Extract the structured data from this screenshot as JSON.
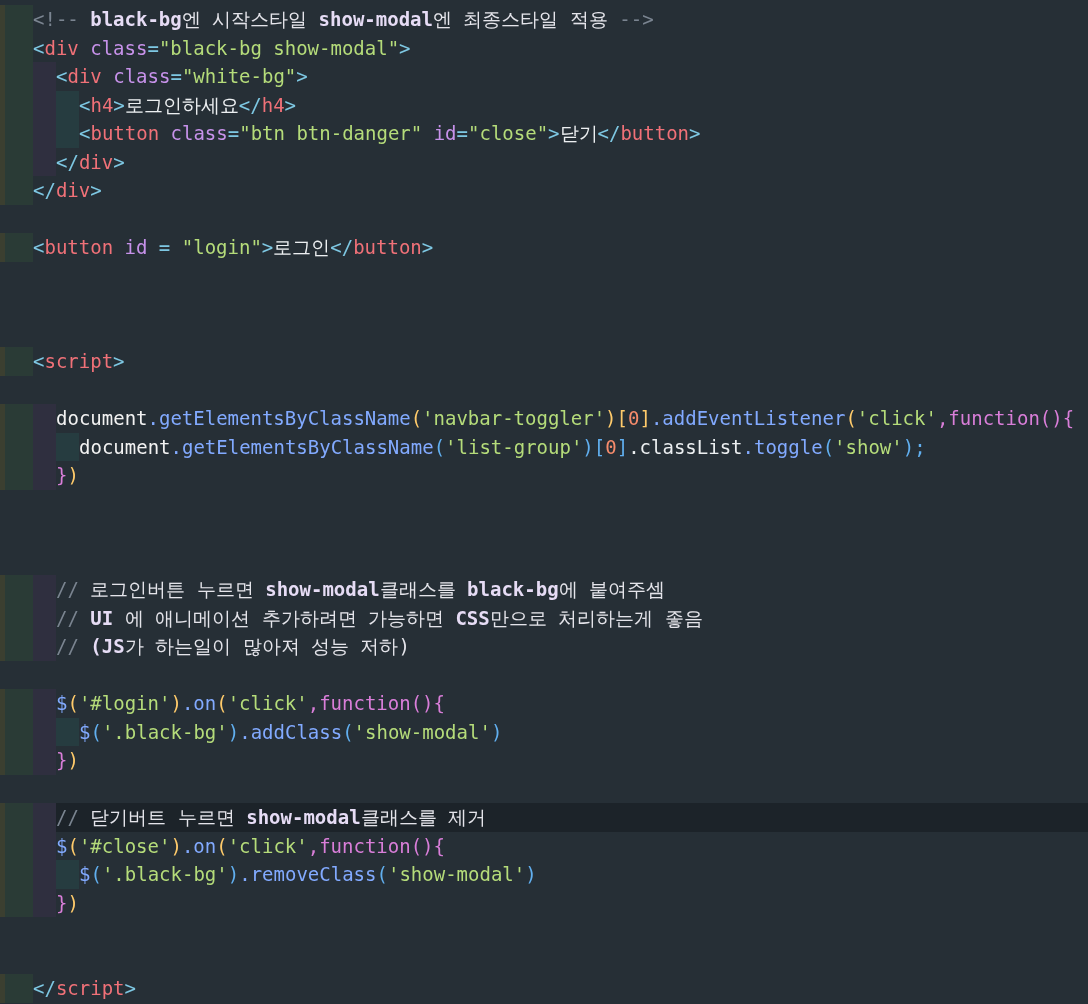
{
  "editor": {
    "lines": [
      {
        "highlighted": false,
        "tokens": [
          {
            "kind": "mark",
            "text": "<!-- "
          },
          {
            "kind": "ccode",
            "text": "black-bg"
          },
          {
            "kind": "ctext",
            "text": "엔 시작스타일 "
          },
          {
            "kind": "ccode",
            "text": "show-modal"
          },
          {
            "kind": "ctext",
            "text": "엔 최종스타일 적용 "
          },
          {
            "kind": "mark",
            "text": "-->"
          }
        ]
      },
      {
        "highlighted": false,
        "tokens": [
          {
            "kind": "punct",
            "text": "<"
          },
          {
            "kind": "tag",
            "text": "div"
          },
          {
            "kind": "attr",
            "text": " class"
          },
          {
            "kind": "punct",
            "text": "="
          },
          {
            "kind": "str",
            "text": "\"black-bg show-modal\""
          },
          {
            "kind": "punct",
            "text": ">"
          }
        ]
      },
      {
        "highlighted": false,
        "guides": [
          {
            "kind": "outer"
          }
        ],
        "tokens": [
          {
            "kind": "punct",
            "text": "<"
          },
          {
            "kind": "tag",
            "text": "div"
          },
          {
            "kind": "attr",
            "text": " class"
          },
          {
            "kind": "punct",
            "text": "="
          },
          {
            "kind": "str",
            "text": "\"white-bg\""
          },
          {
            "kind": "punct",
            "text": ">"
          }
        ]
      },
      {
        "highlighted": false,
        "guides": [
          {
            "kind": "outer"
          },
          {
            "kind": "inner"
          }
        ],
        "tokens": [
          {
            "kind": "punct",
            "text": "<"
          },
          {
            "kind": "tag",
            "text": "h4"
          },
          {
            "kind": "punct",
            "text": ">"
          },
          {
            "kind": "text",
            "text": "로그인하세요"
          },
          {
            "kind": "punct",
            "text": "</"
          },
          {
            "kind": "tag",
            "text": "h4"
          },
          {
            "kind": "punct",
            "text": ">"
          }
        ]
      },
      {
        "highlighted": false,
        "guides": [
          {
            "kind": "outer"
          },
          {
            "kind": "inner"
          }
        ],
        "tokens": [
          {
            "kind": "punct",
            "text": "<"
          },
          {
            "kind": "tag",
            "text": "button"
          },
          {
            "kind": "attr",
            "text": " class"
          },
          {
            "kind": "punct",
            "text": "="
          },
          {
            "kind": "str",
            "text": "\"btn btn-danger\""
          },
          {
            "kind": "attr",
            "text": " id"
          },
          {
            "kind": "punct",
            "text": "="
          },
          {
            "kind": "str",
            "text": "\"close\""
          },
          {
            "kind": "punct",
            "text": ">"
          },
          {
            "kind": "text",
            "text": "닫기"
          },
          {
            "kind": "punct",
            "text": "</"
          },
          {
            "kind": "tag",
            "text": "button"
          },
          {
            "kind": "punct",
            "text": ">"
          }
        ]
      },
      {
        "highlighted": false,
        "guides": [
          {
            "kind": "outer"
          }
        ],
        "tokens": [
          {
            "kind": "punct",
            "text": "</"
          },
          {
            "kind": "tag",
            "text": "div"
          },
          {
            "kind": "punct",
            "text": ">"
          }
        ]
      },
      {
        "highlighted": false,
        "tokens": [
          {
            "kind": "punct",
            "text": "</"
          },
          {
            "kind": "tag",
            "text": "div"
          },
          {
            "kind": "punct",
            "text": ">"
          }
        ]
      },
      {
        "highlighted": false
      },
      {
        "highlighted": false,
        "tokens": [
          {
            "kind": "punct",
            "text": "<"
          },
          {
            "kind": "tag",
            "text": "button"
          },
          {
            "kind": "attr",
            "text": " id"
          },
          {
            "kind": "punct",
            "text": " = "
          },
          {
            "kind": "str",
            "text": "\"login\""
          },
          {
            "kind": "punct",
            "text": ">"
          },
          {
            "kind": "text",
            "text": "로그인"
          },
          {
            "kind": "punct",
            "text": "</"
          },
          {
            "kind": "tag",
            "text": "button"
          },
          {
            "kind": "punct",
            "text": ">"
          }
        ]
      },
      {
        "highlighted": false
      },
      {
        "highlighted": false
      },
      {
        "highlighted": false
      },
      {
        "highlighted": false,
        "tokens": [
          {
            "kind": "punct",
            "text": "<"
          },
          {
            "kind": "tag",
            "text": "script"
          },
          {
            "kind": "punct",
            "text": ">"
          }
        ]
      },
      {
        "highlighted": false
      },
      {
        "highlighted": false,
        "guides": [
          {
            "kind": "outer"
          }
        ],
        "tokens": [
          {
            "kind": "ident",
            "text": "document"
          },
          {
            "kind": "method",
            "text": ".getElementsByClassName"
          },
          {
            "kind": "p1",
            "text": "("
          },
          {
            "kind": "str",
            "text": "'navbar-toggler'"
          },
          {
            "kind": "p1",
            "text": ")["
          },
          {
            "kind": "num",
            "text": "0"
          },
          {
            "kind": "p1",
            "text": "]"
          },
          {
            "kind": "method",
            "text": ".addEventListener"
          },
          {
            "kind": "p1",
            "text": "("
          },
          {
            "kind": "str",
            "text": "'click'"
          },
          {
            "kind": "kw",
            "text": ",function(){"
          }
        ]
      },
      {
        "highlighted": false,
        "guides": [
          {
            "kind": "outer"
          },
          {
            "kind": "inner"
          }
        ],
        "tokens": [
          {
            "kind": "ident",
            "text": "document"
          },
          {
            "kind": "method",
            "text": ".getElementsByClassName"
          },
          {
            "kind": "p2",
            "text": "("
          },
          {
            "kind": "str",
            "text": "'list-group'"
          },
          {
            "kind": "p2",
            "text": ")["
          },
          {
            "kind": "num",
            "text": "0"
          },
          {
            "kind": "p2",
            "text": "]"
          },
          {
            "kind": "text",
            "text": ".classList"
          },
          {
            "kind": "method",
            "text": ".toggle"
          },
          {
            "kind": "p2",
            "text": "("
          },
          {
            "kind": "str",
            "text": "'show'"
          },
          {
            "kind": "p2",
            "text": ");"
          }
        ]
      },
      {
        "highlighted": false,
        "guides": [
          {
            "kind": "outer"
          }
        ],
        "tokens": [
          {
            "kind": "kw",
            "text": "}"
          },
          {
            "kind": "p1",
            "text": ")"
          }
        ]
      },
      {
        "highlighted": false
      },
      {
        "highlighted": false
      },
      {
        "highlighted": false
      },
      {
        "highlighted": false,
        "guides": [
          {
            "kind": "outer"
          }
        ],
        "tokens": [
          {
            "kind": "mark",
            "text": "// "
          },
          {
            "kind": "ctext",
            "text": "로그인버튼 누르면 "
          },
          {
            "kind": "ccode",
            "text": "show-modal"
          },
          {
            "kind": "ctext",
            "text": "클래스를 "
          },
          {
            "kind": "ccode",
            "text": "black-bg"
          },
          {
            "kind": "ctext",
            "text": "에 붙여주셈"
          }
        ]
      },
      {
        "highlighted": false,
        "guides": [
          {
            "kind": "outer"
          }
        ],
        "tokens": [
          {
            "kind": "mark",
            "text": "// "
          },
          {
            "kind": "ccode",
            "text": "UI"
          },
          {
            "kind": "ctext",
            "text": " 에 애니메이션 추가하려면 가능하면 "
          },
          {
            "kind": "ccode",
            "text": "CSS"
          },
          {
            "kind": "ctext",
            "text": "만으로 처리하는게 좋음"
          }
        ]
      },
      {
        "highlighted": false,
        "guides": [
          {
            "kind": "outer"
          }
        ],
        "tokens": [
          {
            "kind": "mark",
            "text": "// "
          },
          {
            "kind": "ccode",
            "text": "(JS"
          },
          {
            "kind": "ctext",
            "text": "가 하는일이 많아져 성능 저하)"
          }
        ]
      },
      {
        "highlighted": false
      },
      {
        "highlighted": false,
        "guides": [
          {
            "kind": "outer"
          }
        ],
        "tokens": [
          {
            "kind": "method",
            "text": "$"
          },
          {
            "kind": "p1",
            "text": "("
          },
          {
            "kind": "str",
            "text": "'#login'"
          },
          {
            "kind": "p1",
            "text": ")"
          },
          {
            "kind": "method",
            "text": ".on"
          },
          {
            "kind": "p1",
            "text": "("
          },
          {
            "kind": "str",
            "text": "'click'"
          },
          {
            "kind": "kw",
            "text": ",function(){"
          }
        ]
      },
      {
        "highlighted": false,
        "guides": [
          {
            "kind": "outer"
          },
          {
            "kind": "inner"
          }
        ],
        "tokens": [
          {
            "kind": "method",
            "text": "$"
          },
          {
            "kind": "p2",
            "text": "("
          },
          {
            "kind": "str",
            "text": "'.black-bg'"
          },
          {
            "kind": "p2",
            "text": ")"
          },
          {
            "kind": "method",
            "text": ".addClass"
          },
          {
            "kind": "p2",
            "text": "("
          },
          {
            "kind": "str",
            "text": "'show-modal'"
          },
          {
            "kind": "p2",
            "text": ")"
          }
        ]
      },
      {
        "highlighted": false,
        "guides": [
          {
            "kind": "outer"
          }
        ],
        "tokens": [
          {
            "kind": "kw",
            "text": "}"
          },
          {
            "kind": "p1",
            "text": ")"
          }
        ]
      },
      {
        "highlighted": false
      },
      {
        "highlighted": true,
        "guides": [
          {
            "kind": "outer"
          }
        ],
        "tokens": [
          {
            "kind": "mark",
            "text": "// "
          },
          {
            "kind": "ctext",
            "text": "닫기버트 누르면 "
          },
          {
            "kind": "ccode",
            "text": "show-modal"
          },
          {
            "kind": "ctext",
            "text": "클래스를 제거"
          }
        ]
      },
      {
        "highlighted": false,
        "guides": [
          {
            "kind": "outer"
          }
        ],
        "tokens": [
          {
            "kind": "method",
            "text": "$"
          },
          {
            "kind": "p1",
            "text": "("
          },
          {
            "kind": "str",
            "text": "'#close'"
          },
          {
            "kind": "p1",
            "text": ")"
          },
          {
            "kind": "method",
            "text": ".on"
          },
          {
            "kind": "p1",
            "text": "("
          },
          {
            "kind": "str",
            "text": "'click'"
          },
          {
            "kind": "kw",
            "text": ",function(){"
          }
        ]
      },
      {
        "highlighted": false,
        "guides": [
          {
            "kind": "outer"
          },
          {
            "kind": "inner"
          }
        ],
        "tokens": [
          {
            "kind": "method",
            "text": "$"
          },
          {
            "kind": "p2",
            "text": "("
          },
          {
            "kind": "str",
            "text": "'.black-bg'"
          },
          {
            "kind": "p2",
            "text": ")"
          },
          {
            "kind": "method",
            "text": ".removeClass"
          },
          {
            "kind": "p2",
            "text": "("
          },
          {
            "kind": "str",
            "text": "'show-modal'"
          },
          {
            "kind": "p2",
            "text": ")"
          }
        ]
      },
      {
        "highlighted": false,
        "guides": [
          {
            "kind": "outer"
          }
        ],
        "tokens": [
          {
            "kind": "kw",
            "text": "}"
          },
          {
            "kind": "p1",
            "text": ")"
          }
        ]
      },
      {
        "highlighted": false
      },
      {
        "highlighted": false
      },
      {
        "highlighted": false,
        "tokens": [
          {
            "kind": "punct",
            "text": "</"
          },
          {
            "kind": "tag",
            "text": "script"
          },
          {
            "kind": "punct",
            "text": ">"
          }
        ]
      }
    ]
  }
}
